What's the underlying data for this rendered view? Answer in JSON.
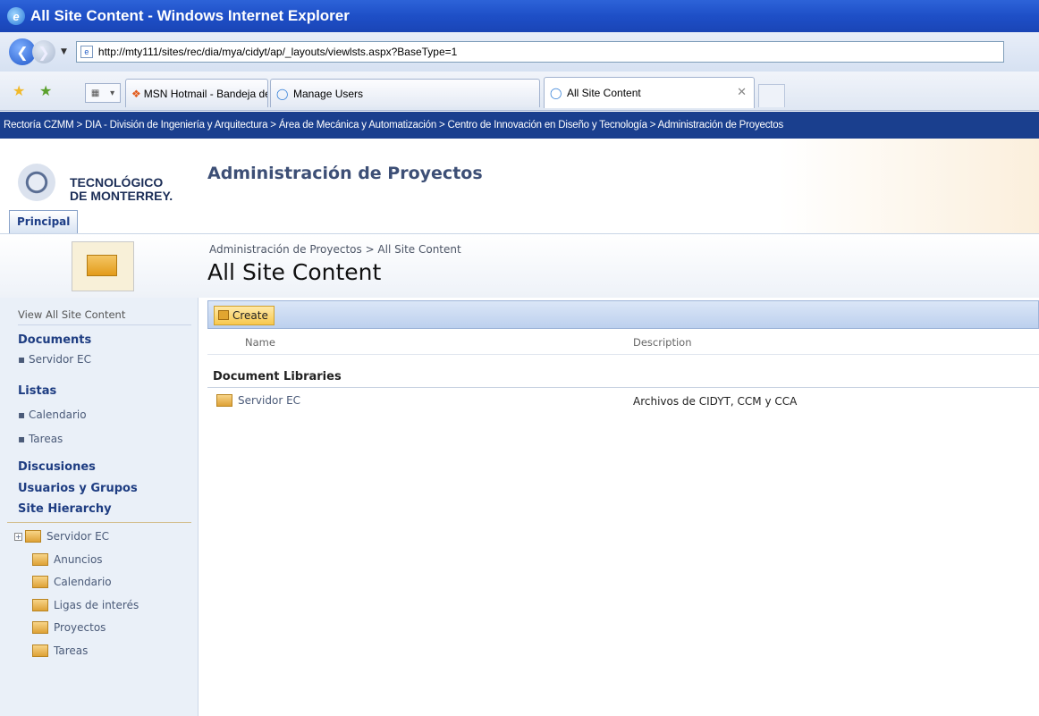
{
  "window": {
    "title": "All Site Content - Windows Internet Explorer"
  },
  "address": {
    "url": "http://mty111/sites/rec/dia/mya/cidyt/ap/_layouts/viewlsts.aspx?BaseType=1"
  },
  "tabs": [
    {
      "label": "MSN Hotmail - Bandeja de en..."
    },
    {
      "label": "Manage Users"
    },
    {
      "label": "All Site Content"
    }
  ],
  "topnav": {
    "breadcrumb": "Rectoría CZMM > DIA - División de Ingeniería y Arquitectura > Área de Mecánica y Automatización > Centro de Innovación en Diseño y Tecnología > Administración de Proyectos"
  },
  "header": {
    "logo_line1": "TECNOLÓGICO",
    "logo_line2": "DE MONTERREY.",
    "site_title": "Administración de Proyectos",
    "tab_principal": "Principal"
  },
  "page": {
    "breadcrumb": "Administración de Proyectos > All Site Content",
    "title": "All Site Content"
  },
  "sidebar": {
    "view_all": "View All Site Content",
    "documents_heading": "Documents",
    "documents": [
      "Servidor EC"
    ],
    "lists_heading": "Listas",
    "lists": [
      "Calendario",
      "Tareas"
    ],
    "discussions_heading": "Discusiones",
    "users_heading": "Usuarios y Grupos",
    "hierarchy_heading": "Site Hierarchy",
    "hierarchy": [
      "Servidor EC",
      "Anuncios",
      "Calendario",
      "Ligas de interés",
      "Proyectos",
      "Tareas"
    ]
  },
  "main": {
    "create_label": "Create",
    "col_name": "Name",
    "col_description": "Description",
    "group_title": "Document Libraries",
    "rows": [
      {
        "name": "Servidor EC",
        "description": "Archivos de CIDYT, CCM y CCA"
      }
    ]
  }
}
